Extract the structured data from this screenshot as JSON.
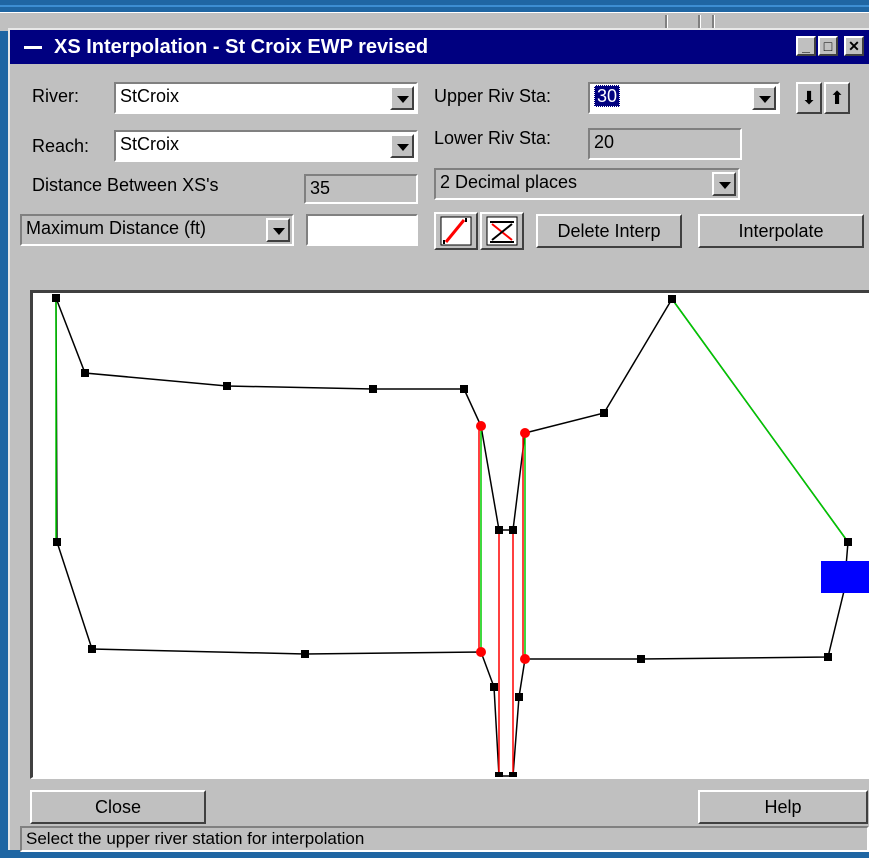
{
  "window": {
    "title": "XS Interpolation  - St Croix EWP revised",
    "controls": {
      "minimize": "_",
      "maximize": "□",
      "close": "✕"
    }
  },
  "form": {
    "river_label": "River:",
    "river_value": "StCroix",
    "reach_label": "Reach:",
    "reach_value": "StCroix",
    "upper_label": "Upper Riv Sta:",
    "upper_value": "30",
    "lower_label": "Lower Riv Sta:",
    "lower_value": "20",
    "distance_label": "Distance Between XS's",
    "distance_value": "35",
    "decimal_value": "2 Decimal places",
    "max_distance_value": "Maximum Distance (ft)",
    "max_distance_input": ""
  },
  "buttons": {
    "delete_interp": "Delete Interp",
    "interpolate": "Interpolate",
    "close": "Close",
    "help": "Help",
    "down_arrow": "⬇",
    "up_arrow": "⬆"
  },
  "icons": {
    "draw_line": "draw-line-icon",
    "delete_line": "delete-line-icon"
  },
  "colors": {
    "title_bar": "#000080",
    "desktop": "#1f66a3",
    "xs_line": "#000000",
    "green_link": "#00cc00",
    "red_link": "#ff0000",
    "blue_marker": "#0000ff"
  },
  "status": {
    "message": "Select the upper river station for interpolation"
  }
}
